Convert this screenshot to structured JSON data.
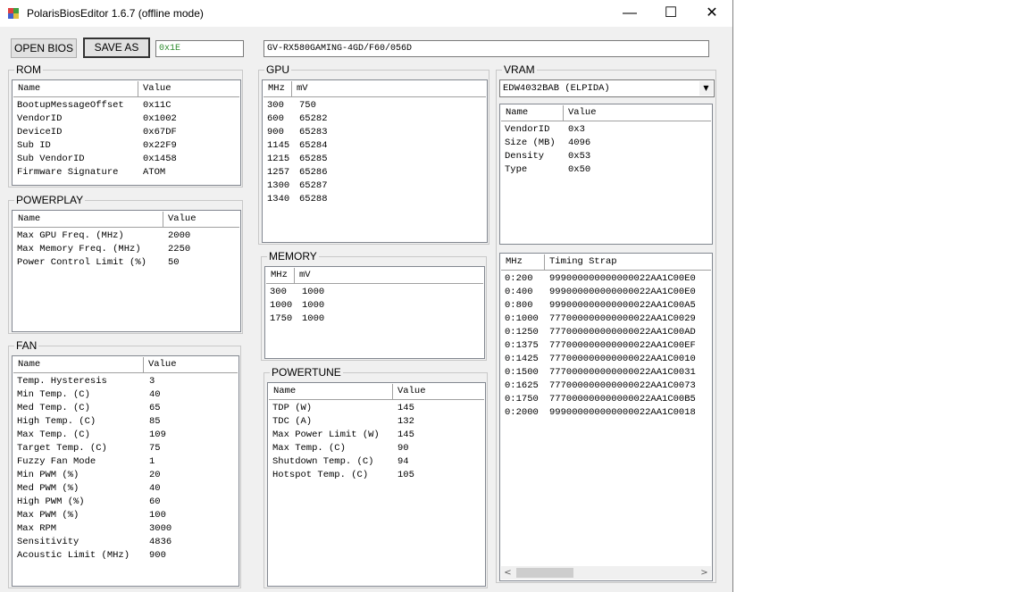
{
  "window": {
    "title": "PolarisBiosEditor 1.6.7 (offline mode)",
    "minimize_icon": "minimize-icon",
    "maximize_icon": "maximize-icon",
    "close_icon": "close-icon"
  },
  "toolbar": {
    "open_label": "OPEN BIOS",
    "save_label": "SAVE AS",
    "checksum_value": "0x1E",
    "bios_name": "GV-RX580GAMING-4GD/F60/056D"
  },
  "rom": {
    "title": "ROM",
    "columns": [
      "Name",
      "Value"
    ],
    "rows": [
      [
        "BootupMessageOffset",
        "0x11C"
      ],
      [
        "VendorID",
        "0x1002"
      ],
      [
        "DeviceID",
        "0x67DF"
      ],
      [
        "Sub ID",
        "0x22F9"
      ],
      [
        "Sub VendorID",
        "0x1458"
      ],
      [
        "Firmware Signature",
        "ATOM"
      ]
    ]
  },
  "powerplay": {
    "title": "POWERPLAY",
    "columns": [
      "Name",
      "Value"
    ],
    "rows": [
      [
        "Max GPU Freq. (MHz)",
        "2000"
      ],
      [
        "Max Memory Freq. (MHz)",
        "2250"
      ],
      [
        "Power Control Limit (%)",
        "50"
      ]
    ]
  },
  "fan": {
    "title": "FAN",
    "columns": [
      "Name",
      "Value"
    ],
    "rows": [
      [
        "Temp. Hysteresis",
        "3"
      ],
      [
        "Min Temp. (C)",
        "40"
      ],
      [
        "Med Temp. (C)",
        "65"
      ],
      [
        "High Temp. (C)",
        "85"
      ],
      [
        "Max Temp. (C)",
        "109"
      ],
      [
        "Target Temp. (C)",
        "75"
      ],
      [
        "Fuzzy Fan Mode",
        "1"
      ],
      [
        "Min PWM (%)",
        "20"
      ],
      [
        "Med PWM (%)",
        "40"
      ],
      [
        "High PWM (%)",
        "60"
      ],
      [
        "Max PWM (%)",
        "100"
      ],
      [
        "Max RPM",
        "3000"
      ],
      [
        "Sensitivity",
        "4836"
      ],
      [
        "Acoustic Limit (MHz)",
        "900"
      ]
    ]
  },
  "gpu": {
    "title": "GPU",
    "columns": [
      "MHz",
      "mV"
    ],
    "rows": [
      [
        "300",
        "750"
      ],
      [
        "600",
        "65282"
      ],
      [
        "900",
        "65283"
      ],
      [
        "1145",
        "65284"
      ],
      [
        "1215",
        "65285"
      ],
      [
        "1257",
        "65286"
      ],
      [
        "1300",
        "65287"
      ],
      [
        "1340",
        "65288"
      ]
    ]
  },
  "memory": {
    "title": "MEMORY",
    "columns": [
      "MHz",
      "mV"
    ],
    "rows": [
      [
        "300",
        "1000"
      ],
      [
        "1000",
        "1000"
      ],
      [
        "1750",
        "1000"
      ]
    ]
  },
  "powertune": {
    "title": "POWERTUNE",
    "columns": [
      "Name",
      "Value"
    ],
    "rows": [
      [
        "TDP (W)",
        "145"
      ],
      [
        "TDC (A)",
        "132"
      ],
      [
        "Max Power Limit (W)",
        "145"
      ],
      [
        "Max Temp. (C)",
        "90"
      ],
      [
        "Shutdown Temp. (C)",
        "94"
      ],
      [
        "Hotspot Temp. (C)",
        "105"
      ]
    ]
  },
  "vram": {
    "title": "VRAM",
    "selected": "EDW4032BAB (ELPIDA)",
    "info_columns": [
      "Name",
      "Value"
    ],
    "info_rows": [
      [
        "VendorID",
        "0x3"
      ],
      [
        "Size (MB)",
        "4096"
      ],
      [
        "Density",
        "0x53"
      ],
      [
        "Type",
        "0x50"
      ]
    ],
    "timing_columns": [
      "MHz",
      "Timing Strap"
    ],
    "timing_rows": [
      [
        "0:200",
        "999000000000000022AA1C00E0"
      ],
      [
        "0:400",
        "999000000000000022AA1C00E0"
      ],
      [
        "0:800",
        "999000000000000022AA1C00A5"
      ],
      [
        "0:1000",
        "777000000000000022AA1C0029"
      ],
      [
        "0:1250",
        "777000000000000022AA1C00AD"
      ],
      [
        "0:1375",
        "777000000000000022AA1C00EF"
      ],
      [
        "0:1425",
        "777000000000000022AA1C0010"
      ],
      [
        "0:1500",
        "777000000000000022AA1C0031"
      ],
      [
        "0:1625",
        "777000000000000022AA1C0073"
      ],
      [
        "0:1750",
        "777000000000000022AA1C00B5"
      ],
      [
        "0:2000",
        "999000000000000022AA1C0018"
      ]
    ]
  }
}
